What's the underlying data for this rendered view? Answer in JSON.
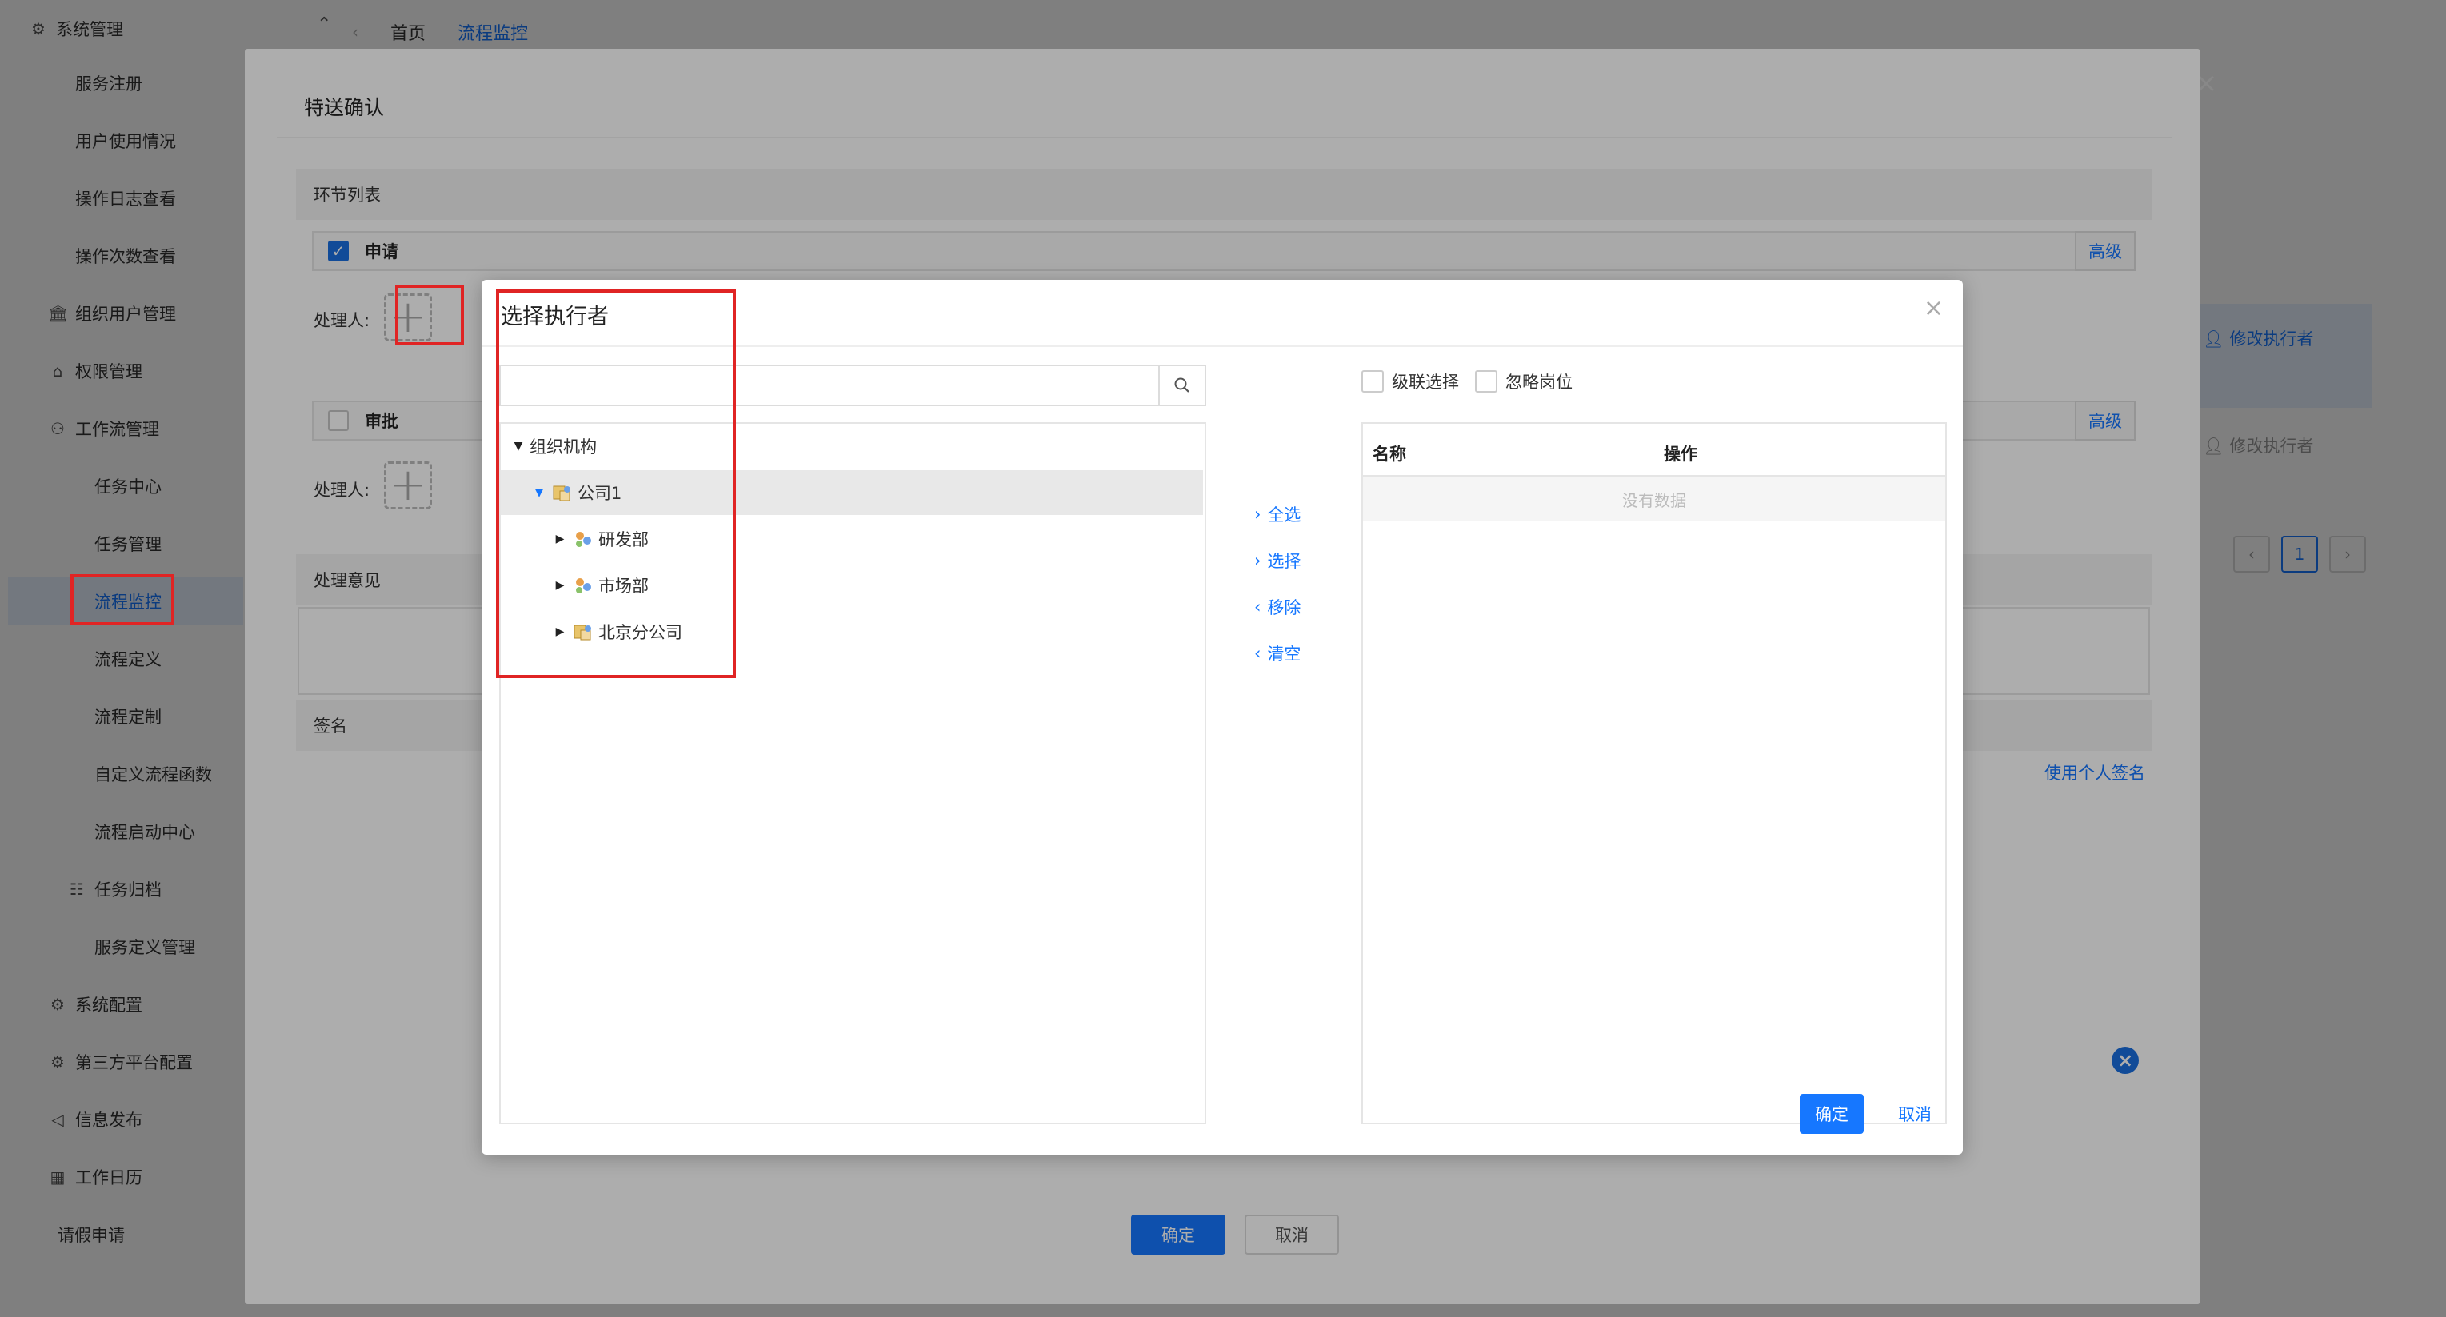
{
  "sidebar": {
    "items": [
      {
        "label": "系统管理",
        "icon": "gear-icon",
        "level": 0
      },
      {
        "label": "服务注册",
        "level": 1
      },
      {
        "label": "用户使用情况",
        "level": 1
      },
      {
        "label": "操作日志查看",
        "level": 1
      },
      {
        "label": "操作次数查看",
        "level": 1
      },
      {
        "label": "组织用户管理",
        "icon": "bank-icon",
        "level": 1
      },
      {
        "label": "权限管理",
        "icon": "key-icon",
        "level": 1
      },
      {
        "label": "工作流管理",
        "icon": "flow-icon",
        "level": 1
      },
      {
        "label": "任务中心",
        "level": 2
      },
      {
        "label": "任务管理",
        "level": 2
      },
      {
        "label": "流程监控",
        "level": 2,
        "active": true
      },
      {
        "label": "流程定义",
        "level": 2
      },
      {
        "label": "流程定制",
        "level": 2
      },
      {
        "label": "自定义流程函数",
        "level": 2
      },
      {
        "label": "流程启动中心",
        "level": 2
      },
      {
        "label": "任务归档",
        "icon": "archive-icon",
        "level": 2
      },
      {
        "label": "服务定义管理",
        "level": 2
      },
      {
        "label": "系统配置",
        "icon": "gear-icon",
        "level": 1
      },
      {
        "label": "第三方平台配置",
        "icon": "gear-icon",
        "level": 1
      },
      {
        "label": "信息发布",
        "icon": "megaphone-icon",
        "level": 1
      },
      {
        "label": "工作日历",
        "icon": "calendar-icon",
        "level": 1
      },
      {
        "label": "请假申请",
        "level": 1
      }
    ]
  },
  "tabs": {
    "home": "首页",
    "active": "流程监控"
  },
  "page": {
    "modify_executor": "修改执行者",
    "pager_current": "1"
  },
  "confirm_dialog": {
    "title": "特送确认",
    "node_list_label": "环节列表",
    "nodes": [
      {
        "name": "申请",
        "checked": true,
        "advanced": "高级"
      },
      {
        "name": "审批",
        "checked": false,
        "advanced": "高级"
      }
    ],
    "handler_label": "处理人:",
    "opinion_label": "处理意见",
    "signature_label": "签名",
    "use_personal_signature": "使用个人签名",
    "ok": "确定",
    "cancel": "取消"
  },
  "executor_dialog": {
    "title": "选择执行者",
    "search_placeholder": "",
    "tree": [
      {
        "label": "组织机构",
        "depth": 0,
        "expanded": true
      },
      {
        "label": "公司1",
        "depth": 1,
        "expanded": true,
        "selected": true
      },
      {
        "label": "研发部",
        "depth": 2,
        "expanded": false
      },
      {
        "label": "市场部",
        "depth": 2,
        "expanded": false
      },
      {
        "label": "北京分公司",
        "depth": 2,
        "expanded": false
      }
    ],
    "ops": {
      "select_all": "全选",
      "select": "选择",
      "remove": "移除",
      "clear": "清空"
    },
    "options": {
      "cascade": "级联选择",
      "ignore_post": "忽略岗位"
    },
    "table": {
      "col_name": "名称",
      "col_action": "操作",
      "empty": "没有数据"
    },
    "ok": "确定",
    "cancel": "取消"
  },
  "colors": {
    "accent": "#1677ff",
    "highlight": "#e02424"
  }
}
